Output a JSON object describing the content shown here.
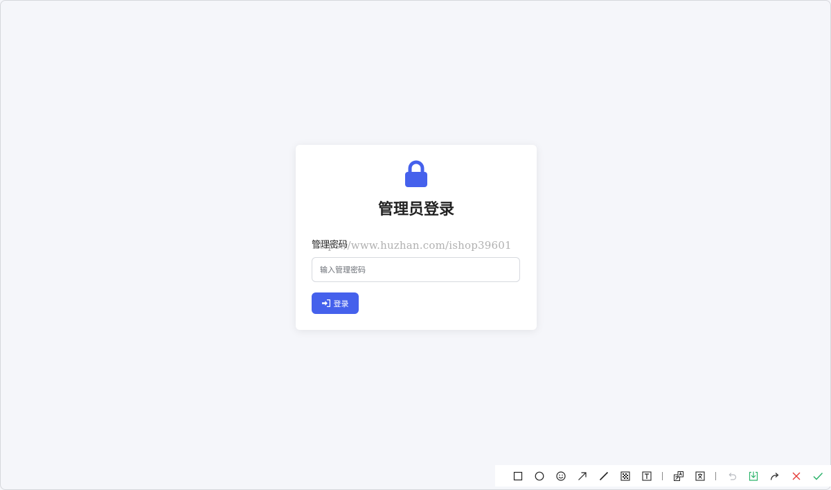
{
  "login": {
    "title": "管理员登录",
    "field_label": "管理密码",
    "password_placeholder": "输入管理密码",
    "password_value": "",
    "button_label": "登录",
    "accent_color": "#4561ec"
  },
  "watermark": {
    "text": "https://www.huzhan.com/ishop39601"
  },
  "toolbar": {
    "tools": [
      {
        "icon": "rectangle-icon"
      },
      {
        "icon": "circle-icon"
      },
      {
        "icon": "emoji-icon"
      },
      {
        "icon": "arrow-icon"
      },
      {
        "icon": "line-icon"
      },
      {
        "icon": "mosaic-icon"
      },
      {
        "icon": "text-icon"
      },
      {
        "icon": "translate-icon"
      },
      {
        "icon": "ocr-text-icon"
      },
      {
        "icon": "undo-icon"
      },
      {
        "icon": "save-icon"
      },
      {
        "icon": "share-icon"
      },
      {
        "icon": "close-icon"
      },
      {
        "icon": "confirm-icon"
      }
    ]
  }
}
